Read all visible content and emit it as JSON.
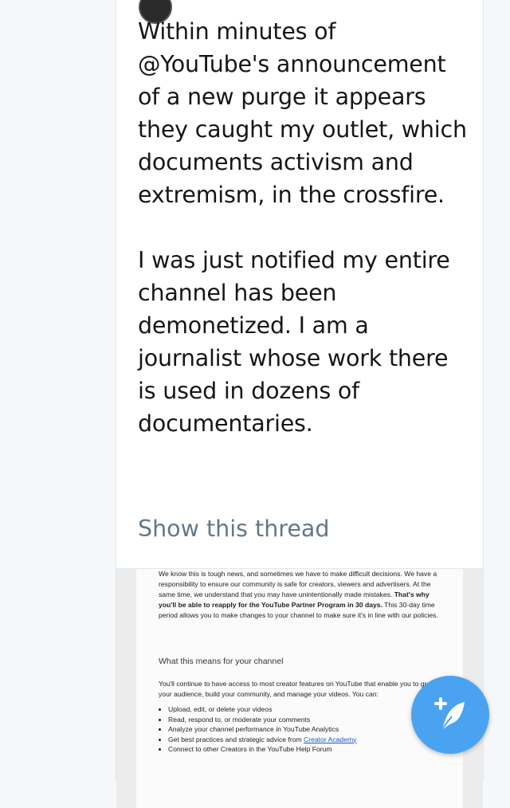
{
  "tweet": {
    "paragraph1": "Within minutes of @YouTube's announcement of a new purge it appears they caught my outlet, which documents activism and extremism, in the crossfire.",
    "paragraph2": "I was just notified my entire channel has been demonetized. I am a journalist whose work there is used in dozens of documentaries.",
    "show_thread": "Show this thread"
  },
  "media": {
    "intro_text": "We know this is tough news, and sometimes we have to make difficult decisions. We have a responsibility to ensure our community is safe for creators, viewers and advertisers. At the same time, we understand that you may have unintentionally made mistakes. ",
    "intro_bold": "That's why you'll be able to reapply for the YouTube Partner Program in 30 days.",
    "intro_tail": " This 30-day time period allows you to make changes to your channel to make sure it's in line with our policies.",
    "heading": "What this means for your channel",
    "body2": "You'll continue to have access to most creator features on YouTube that enable you to grow your audience, build your community, and manage your videos. You can:",
    "list": [
      "Upload, edit, or delete your videos",
      "Read, respond to, or moderate your comments",
      "Analyze your channel performance in YouTube Analytics"
    ],
    "list_item4_prefix": "Get best practices and strategic advice from ",
    "list_item4_link": "Creator Academy",
    "list_item5": "Connect to other Creators in the YouTube Help Forum"
  },
  "colors": {
    "accent": "#4aa3f0",
    "text": "#14171a",
    "muted": "#657786"
  },
  "icons": {
    "fab": "compose-tweet-icon",
    "avatar": "avatar"
  }
}
